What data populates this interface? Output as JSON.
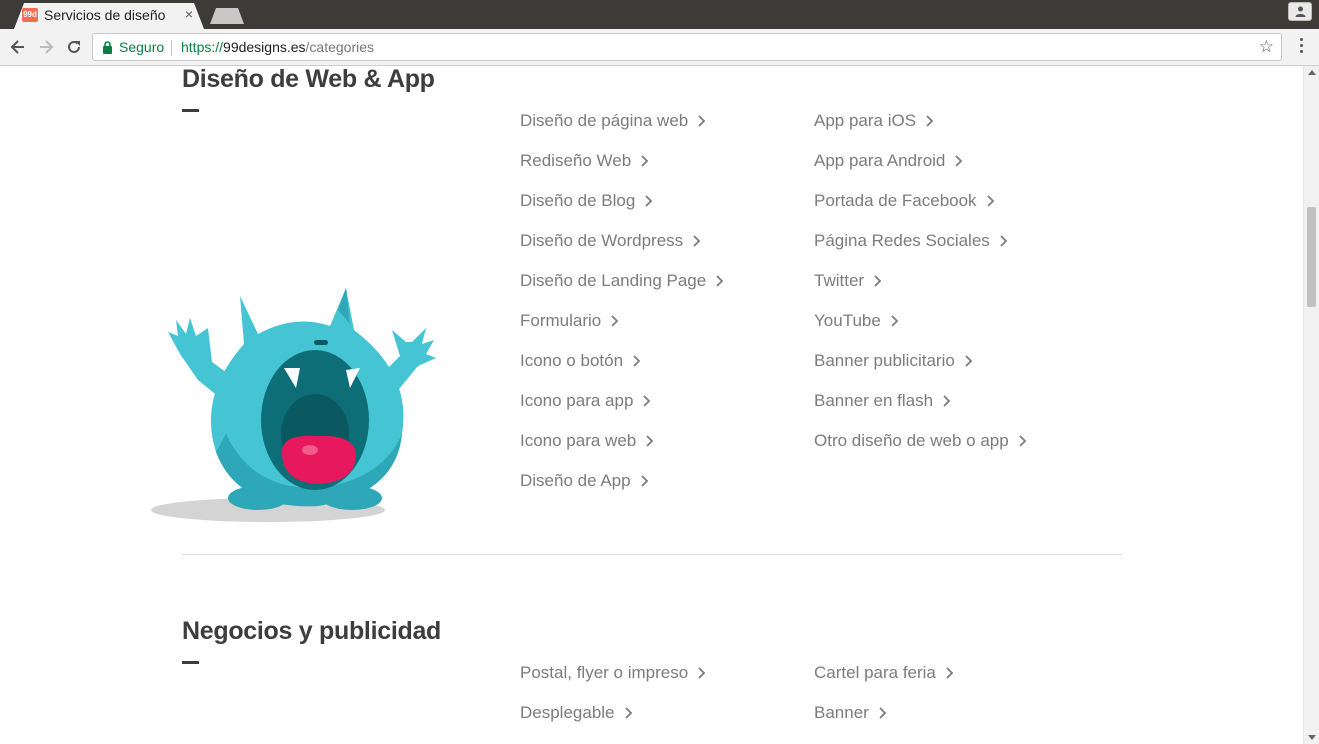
{
  "browser": {
    "tab": {
      "favicon_text": "99d",
      "title": "Servicios de diseño",
      "close": "×"
    },
    "omnibox": {
      "secure_label": "Seguro",
      "url_scheme": "https://",
      "url_host": "99designs.es",
      "url_path": "/categories",
      "star": "☆"
    }
  },
  "sections": [
    {
      "title": "Diseño de Web & App",
      "columns": [
        [
          "Diseño de página web",
          "Rediseño Web",
          "Diseño de Blog",
          "Diseño de Wordpress",
          "Diseño de Landing Page",
          "Formulario",
          "Icono o botón",
          "Icono para app",
          "Icono para web",
          "Diseño de App"
        ],
        [
          "App para iOS",
          "App para Android",
          "Portada de Facebook",
          "Página Redes Sociales",
          "Twitter",
          "YouTube",
          "Banner publicitario",
          "Banner en flash",
          "Otro diseño de web o app"
        ]
      ]
    },
    {
      "title": "Negocios y publicidad",
      "columns": [
        [
          "Postal, flyer o impreso",
          "Desplegable"
        ],
        [
          "Cartel para feria",
          "Banner"
        ]
      ]
    }
  ],
  "colors": {
    "accent_secure": "#0b8043",
    "heading": "#3d3d3d",
    "link": "#7c7c7c",
    "mascot_body": "#45c4d4",
    "mascot_tongue": "#e8185e"
  }
}
